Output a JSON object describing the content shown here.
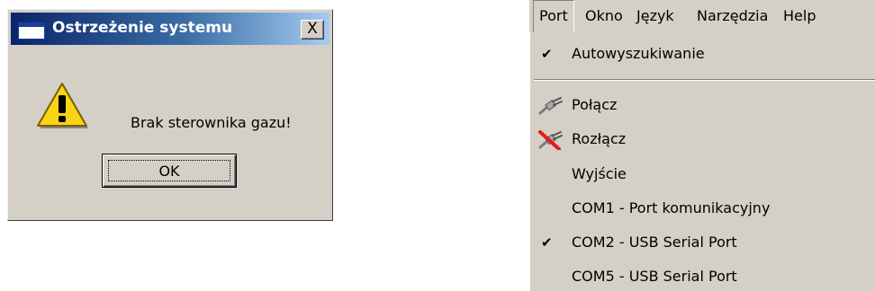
{
  "dialog": {
    "title": "Ostrzeżenie systemu",
    "close_label": "X",
    "message": "Brak sterownika gazu!",
    "ok_label": "OK",
    "icon": "warning-icon"
  },
  "menubar": {
    "items": [
      "Port",
      "Okno",
      "Język",
      "Narzędzia",
      "Help"
    ],
    "active": "Port"
  },
  "port_menu": {
    "items": [
      {
        "label": "Autowyszukiwanie",
        "checked": true
      },
      {
        "label": "Połącz",
        "icon": "connect-plug-icon"
      },
      {
        "label": "Rozłącz",
        "icon": "disconnect-plug-icon"
      },
      {
        "label": "Wyjście"
      },
      {
        "label": "COM1 - Port komunikacyjny"
      },
      {
        "label": "COM2 - USB Serial Port",
        "checked": true
      },
      {
        "label": "COM5 - USB Serial Port"
      }
    ],
    "check_glyph": "✔"
  }
}
